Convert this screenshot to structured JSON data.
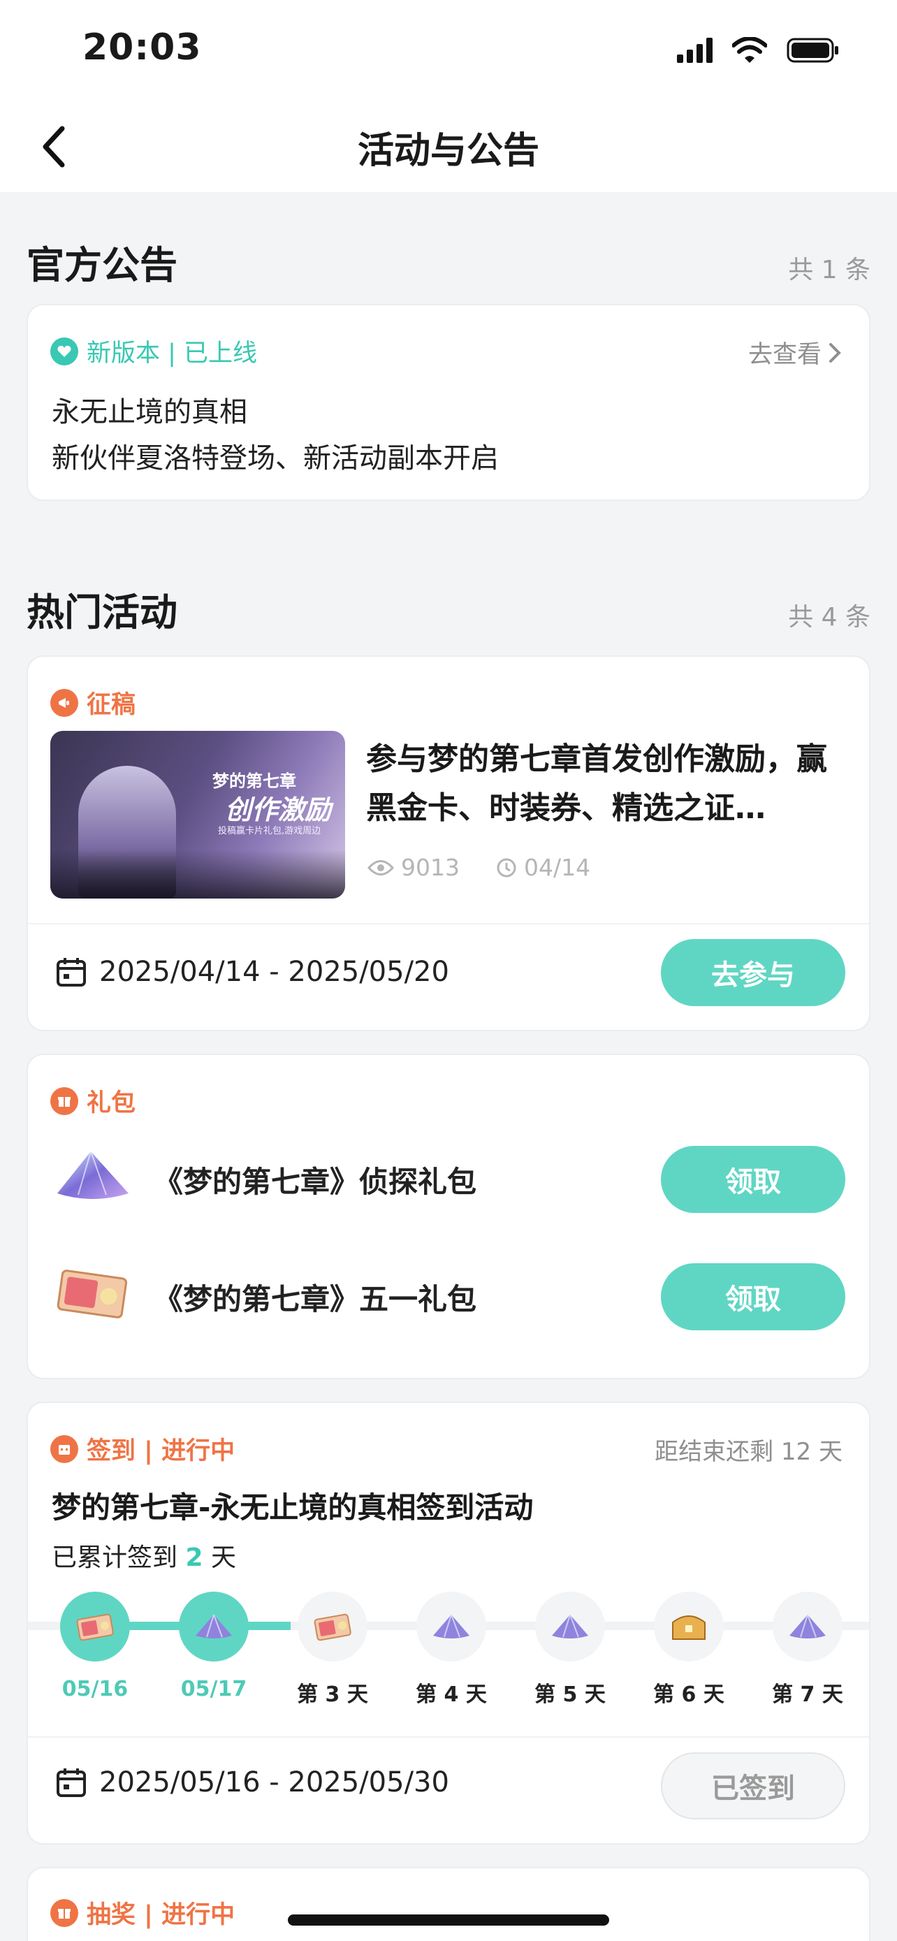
{
  "status": {
    "time": "20:03"
  },
  "nav": {
    "title": "活动与公告"
  },
  "official": {
    "title": "官方公告",
    "count": "共 1 条",
    "tag": "新版本 | 已上线",
    "action": "去查看",
    "headline": "永无止境的真相",
    "desc": "新伙伴夏洛特登场、新活动副本开启"
  },
  "hot": {
    "title": "热门活动",
    "count": "共 4 条"
  },
  "submission": {
    "tag": "征稿",
    "banner_line1": "梦的第七章",
    "banner_line2": "创作激励",
    "banner_line3": "投稿赢卡片礼包,游戏周边",
    "title": "参与梦的第七章首发创作激励，赢黑金卡、时装券、精选之证…",
    "views": "9013",
    "date": "04/14",
    "range": "2025/04/14 - 2025/05/20",
    "button": "去参与"
  },
  "gifts": {
    "tag": "礼包",
    "items": [
      {
        "name": "《梦的第七章》侦探礼包",
        "button": "领取"
      },
      {
        "name": "《梦的第七章》五一礼包",
        "button": "领取"
      }
    ]
  },
  "checkin": {
    "tag": "签到 | 进行中",
    "remaining": "距结束还剩 12 天",
    "title": "梦的第七章-永无止境的真相签到活动",
    "progress_prefix": "已累计签到 ",
    "progress_value": "2",
    "progress_suffix": " 天",
    "days": [
      "05/16",
      "05/17",
      "第 3 天",
      "第 4 天",
      "第 5 天",
      "第 6 天",
      "第 7 天"
    ],
    "completed": 2,
    "range": "2025/05/16 - 2025/05/30",
    "button": "已签到"
  },
  "lottery": {
    "tag": "抽奖 | 进行中"
  },
  "colors": {
    "accent": "#5fd6c3",
    "accent_text": "#39c8b2",
    "orange": "#ef7445"
  }
}
